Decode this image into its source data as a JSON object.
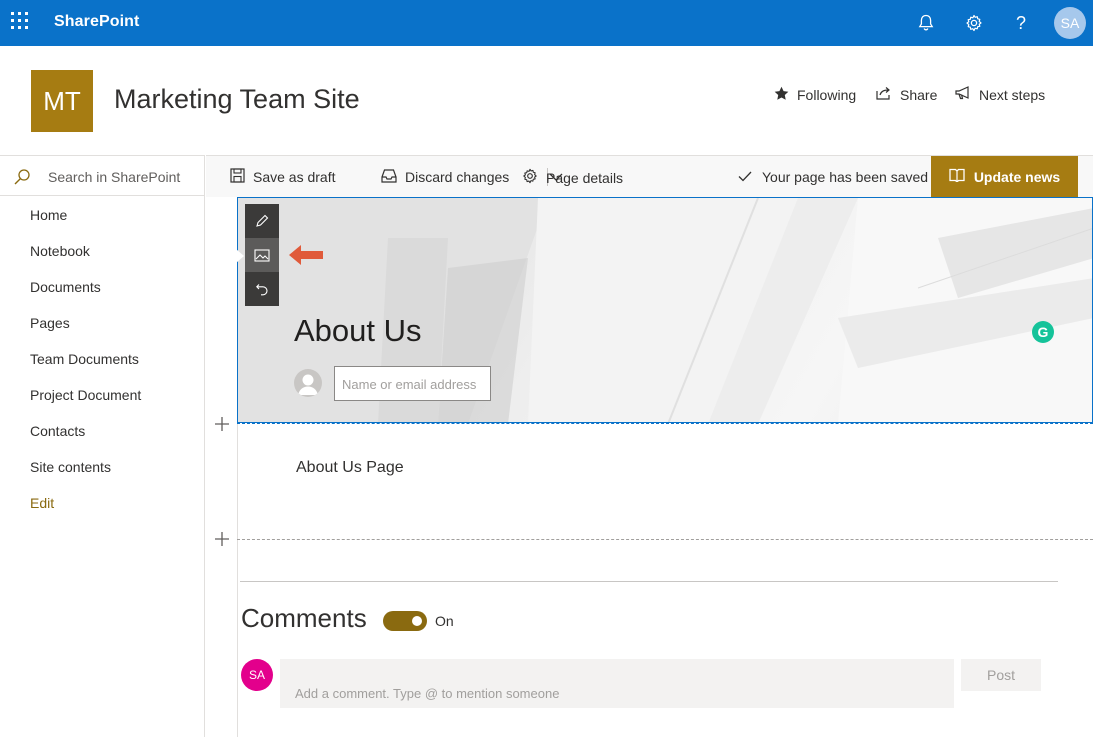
{
  "suitebar": {
    "app_name": "SharePoint",
    "icons": [
      "waffle-icon",
      "bell-icon",
      "gear-icon",
      "help-icon"
    ],
    "user_initials": "SA",
    "bg_color": "#0a72c9"
  },
  "site": {
    "logo_initials": "MT",
    "title": "Marketing Team Site",
    "logo_color": "#a67c12",
    "actions": {
      "following": "Following",
      "share": "Share",
      "next_steps": "Next steps"
    }
  },
  "nav": {
    "search_placeholder": "Search in SharePoint",
    "items": [
      {
        "label": "Home"
      },
      {
        "label": "Notebook"
      },
      {
        "label": "Documents"
      },
      {
        "label": "Pages"
      },
      {
        "label": "Team Documents"
      },
      {
        "label": "Project Document"
      },
      {
        "label": "Contacts"
      },
      {
        "label": "Site contents"
      },
      {
        "label": "Edit"
      }
    ]
  },
  "commandbar": {
    "save_draft": "Save as draft",
    "discard": "Discard changes",
    "page_details": "Page details",
    "saved_status": "Your page has been saved",
    "update_news": "Update news"
  },
  "hero": {
    "title": "About Us",
    "author_placeholder": "Name or email address",
    "toolbar_icons": [
      "edit-icon",
      "change-image-icon",
      "reset-icon"
    ],
    "grammarly_label": "G"
  },
  "content": {
    "text_part": "About Us Page"
  },
  "comments": {
    "title": "Comments",
    "toggle_label": "On",
    "toggle_on": true,
    "commenter_initials": "SA",
    "comment_placeholder": "Add a comment. Type @ to mention someone",
    "post_label": "Post"
  }
}
